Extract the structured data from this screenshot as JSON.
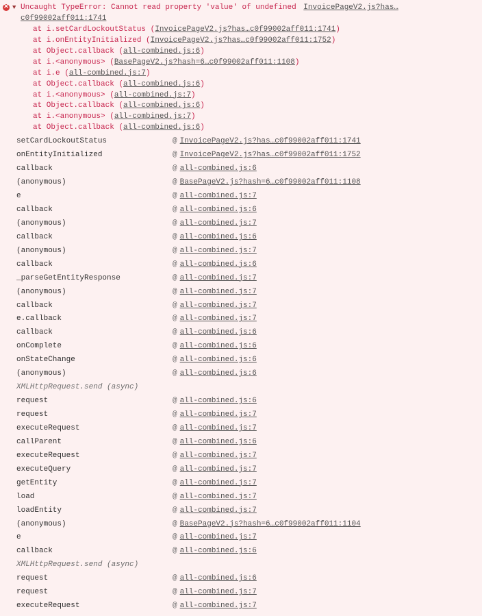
{
  "error": {
    "icon": "error-circle",
    "message": "Uncaught TypeError: Cannot read property 'value' of undefined",
    "top_link": "InvoicePageV2.js?has…c0f99002aff011:1741"
  },
  "red_stack": [
    {
      "prefix": "at i.setCardLockoutStatus (",
      "link": "InvoicePageV2.js?has…c0f99002aff011:1741",
      "suffix": ")"
    },
    {
      "prefix": "at i.onEntityInitialized (",
      "link": "InvoicePageV2.js?has…c0f99002aff011:1752",
      "suffix": ")"
    },
    {
      "prefix": "at Object.callback (",
      "link": "all-combined.js:6",
      "suffix": ")"
    },
    {
      "prefix": "at i.<anonymous> (",
      "link": "BasePageV2.js?hash=6…c0f99002aff011:1108",
      "suffix": ")"
    },
    {
      "prefix": "at i.e (",
      "link": "all-combined.js:7",
      "suffix": ")"
    },
    {
      "prefix": "at Object.callback (",
      "link": "all-combined.js:6",
      "suffix": ")"
    },
    {
      "prefix": "at i.<anonymous> (",
      "link": "all-combined.js:7",
      "suffix": ")"
    },
    {
      "prefix": "at Object.callback (",
      "link": "all-combined.js:6",
      "suffix": ")"
    },
    {
      "prefix": "at i.<anonymous> (",
      "link": "all-combined.js:7",
      "suffix": ")"
    },
    {
      "prefix": "at Object.callback (",
      "link": "all-combined.js:6",
      "suffix": ")"
    }
  ],
  "frames": [
    {
      "fn": "setCardLockoutStatus",
      "loc": "InvoicePageV2.js?has…c0f99002aff011:1741"
    },
    {
      "fn": "onEntityInitialized",
      "loc": "InvoicePageV2.js?has…c0f99002aff011:1752"
    },
    {
      "fn": "callback",
      "loc": "all-combined.js:6"
    },
    {
      "fn": "(anonymous)",
      "loc": "BasePageV2.js?hash=6…c0f99002aff011:1108"
    },
    {
      "fn": "e",
      "loc": "all-combined.js:7"
    },
    {
      "fn": "callback",
      "loc": "all-combined.js:6"
    },
    {
      "fn": "(anonymous)",
      "loc": "all-combined.js:7"
    },
    {
      "fn": "callback",
      "loc": "all-combined.js:6"
    },
    {
      "fn": "(anonymous)",
      "loc": "all-combined.js:7"
    },
    {
      "fn": "callback",
      "loc": "all-combined.js:6"
    },
    {
      "fn": "_parseGetEntityResponse",
      "loc": "all-combined.js:7"
    },
    {
      "fn": "(anonymous)",
      "loc": "all-combined.js:7"
    },
    {
      "fn": "callback",
      "loc": "all-combined.js:7"
    },
    {
      "fn": "e.callback",
      "loc": "all-combined.js:7"
    },
    {
      "fn": "callback",
      "loc": "all-combined.js:6"
    },
    {
      "fn": "onComplete",
      "loc": "all-combined.js:6"
    },
    {
      "fn": "onStateChange",
      "loc": "all-combined.js:6"
    },
    {
      "fn": "(anonymous)",
      "loc": "all-combined.js:6"
    },
    {
      "async": "XMLHttpRequest.send (async)"
    },
    {
      "fn": "request",
      "loc": "all-combined.js:6"
    },
    {
      "fn": "request",
      "loc": "all-combined.js:7"
    },
    {
      "fn": "executeRequest",
      "loc": "all-combined.js:7"
    },
    {
      "fn": "callParent",
      "loc": "all-combined.js:6"
    },
    {
      "fn": "executeRequest",
      "loc": "all-combined.js:7"
    },
    {
      "fn": "executeQuery",
      "loc": "all-combined.js:7"
    },
    {
      "fn": "getEntity",
      "loc": "all-combined.js:7"
    },
    {
      "fn": "load",
      "loc": "all-combined.js:7"
    },
    {
      "fn": "loadEntity",
      "loc": "all-combined.js:7"
    },
    {
      "fn": "(anonymous)",
      "loc": "BasePageV2.js?hash=6…c0f99002aff011:1104"
    },
    {
      "fn": "e",
      "loc": "all-combined.js:7"
    },
    {
      "fn": "callback",
      "loc": "all-combined.js:6"
    },
    {
      "async": "XMLHttpRequest.send (async)"
    },
    {
      "fn": "request",
      "loc": "all-combined.js:6"
    },
    {
      "fn": "request",
      "loc": "all-combined.js:7"
    },
    {
      "fn": "executeRequest",
      "loc": "all-combined.js:7"
    }
  ],
  "at_symbol": "@"
}
